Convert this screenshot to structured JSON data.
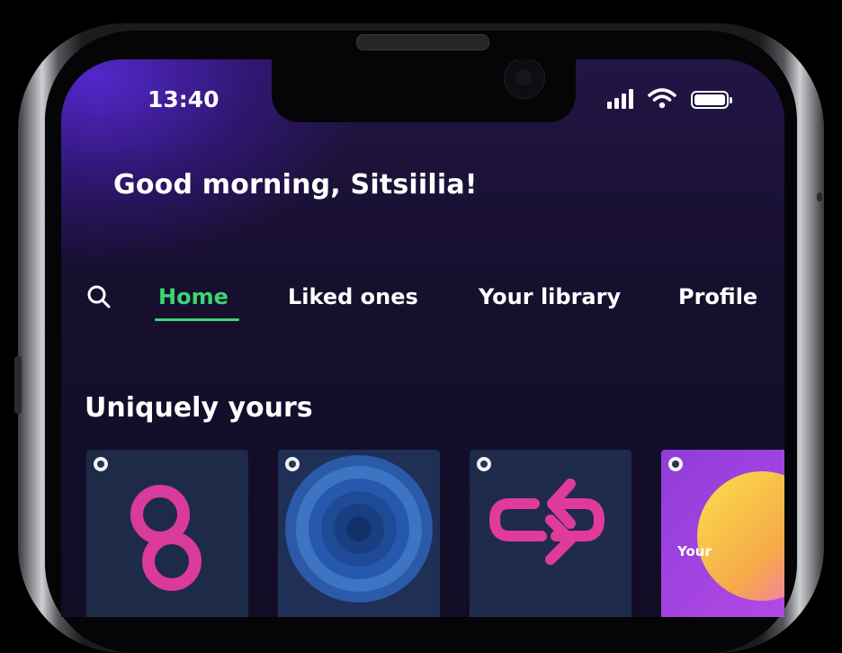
{
  "status_bar": {
    "time": "13:40",
    "icons": [
      "cellular-signal-icon",
      "wifi-icon",
      "battery-icon"
    ]
  },
  "greeting": "Good morning, Sitsiilia!",
  "nav": {
    "search_icon": "search-icon",
    "tabs": [
      {
        "label": "Home",
        "active": true
      },
      {
        "label": "Liked ones",
        "active": false
      },
      {
        "label": "Your library",
        "active": false
      },
      {
        "label": "Profile",
        "active": false
      }
    ]
  },
  "section": {
    "title": "Uniquely yours"
  },
  "cards": [
    {
      "art": "infinity-loop-art"
    },
    {
      "art": "concentric-circles-art"
    },
    {
      "art": "repeat-arrows-art"
    },
    {
      "art": "gradient-circle-art",
      "label": "Your"
    }
  ],
  "colors": {
    "accent_active": "#3ad673",
    "background_top": "#4f24c8",
    "background": "#140d2a",
    "text": "#ffffff"
  }
}
